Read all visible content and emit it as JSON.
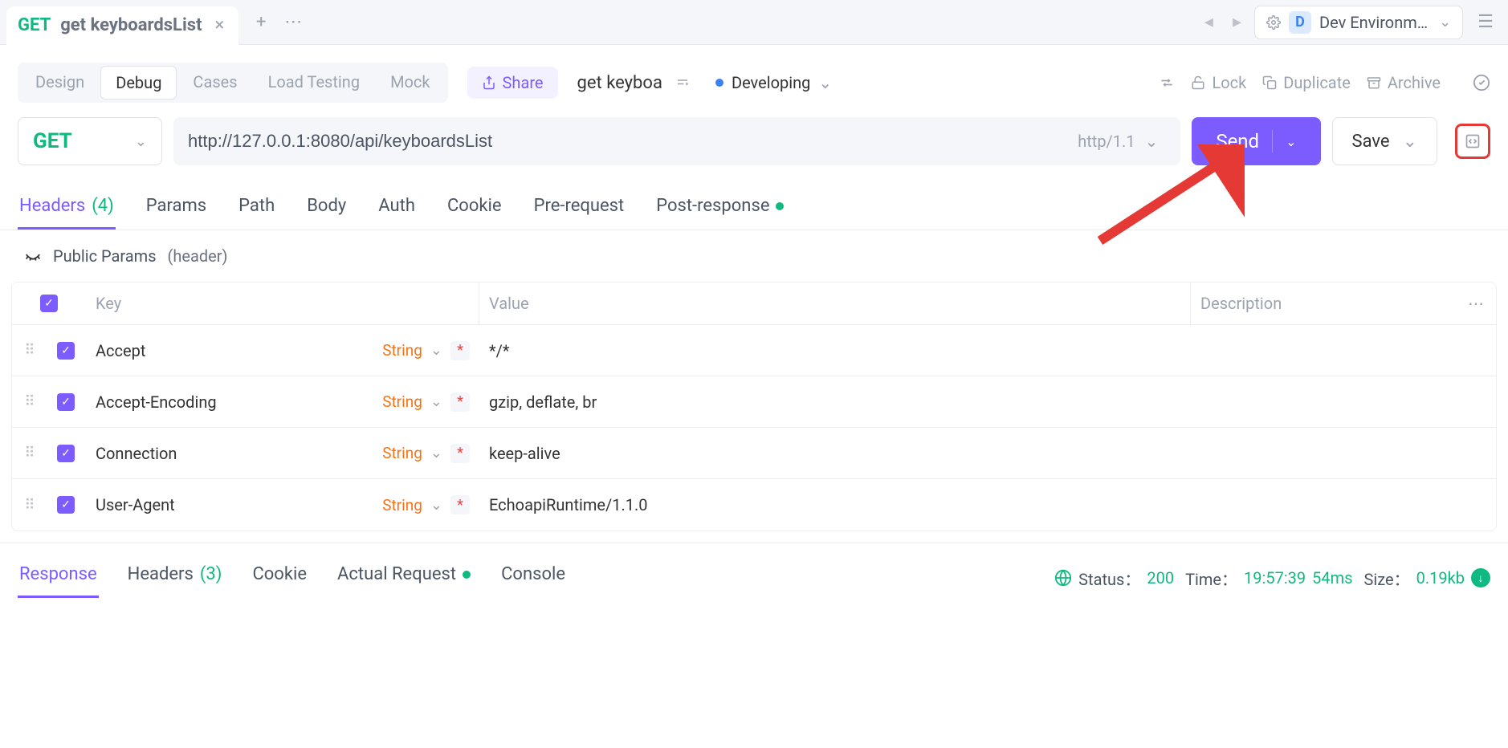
{
  "tab": {
    "method": "GET",
    "title": "get keyboardsList"
  },
  "env": {
    "label": "Dev Environm…",
    "badge": "D"
  },
  "viewTabs": {
    "design": "Design",
    "debug": "Debug",
    "cases": "Cases",
    "loadTesting": "Load Testing",
    "mock": "Mock"
  },
  "share": "Share",
  "requestName": "get keyboa",
  "status": {
    "label": "Developing"
  },
  "actions": {
    "lock": "Lock",
    "duplicate": "Duplicate",
    "archive": "Archive"
  },
  "request": {
    "method": "GET",
    "url": "http://127.0.0.1:8080/api/keyboardsList",
    "protocol": "http/1.1",
    "send": "Send",
    "save": "Save"
  },
  "mainTabs": {
    "headers": "Headers",
    "headersCount": "(4)",
    "params": "Params",
    "path": "Path",
    "body": "Body",
    "auth": "Auth",
    "cookie": "Cookie",
    "preRequest": "Pre-request",
    "postResponse": "Post-response"
  },
  "publicParams": {
    "label": "Public Params",
    "sub": "(header)"
  },
  "table": {
    "headers": {
      "key": "Key",
      "value": "Value",
      "description": "Description"
    },
    "rows": [
      {
        "key": "Accept",
        "type": "String",
        "value": "*/*"
      },
      {
        "key": "Accept-Encoding",
        "type": "String",
        "value": "gzip, deflate, br"
      },
      {
        "key": "Connection",
        "type": "String",
        "value": "keep-alive"
      },
      {
        "key": "User-Agent",
        "type": "String",
        "value": "EchoapiRuntime/1.1.0"
      }
    ]
  },
  "respTabs": {
    "response": "Response",
    "headers": "Headers",
    "headersCount": "(3)",
    "cookie": "Cookie",
    "actualRequest": "Actual Request",
    "console": "Console"
  },
  "respStatus": {
    "statusLabel": "Status：",
    "statusVal": "200",
    "timeLabel": "Time：",
    "timeVal": "19:57:39",
    "duration": "54ms",
    "sizeLabel": "Size：",
    "sizeVal": "0.19kb"
  }
}
